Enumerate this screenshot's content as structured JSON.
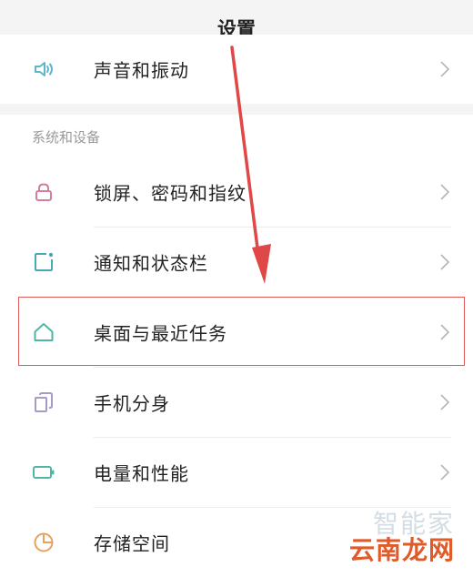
{
  "header": {
    "title": "设置"
  },
  "sections": {
    "system_title": "系统和设备"
  },
  "items": [
    {
      "label": "声音和振动",
      "icon": "speaker-icon",
      "color": "#5db6c9"
    },
    {
      "label": "锁屏、密码和指纹",
      "icon": "lock-icon",
      "color": "#d4809a"
    },
    {
      "label": "通知和状态栏",
      "icon": "notification-icon",
      "color": "#4aa5bd"
    },
    {
      "label": "桌面与最近任务",
      "icon": "home-icon",
      "color": "#4fb7a4"
    },
    {
      "label": "手机分身",
      "icon": "dual-app-icon",
      "color": "#a79ac4"
    },
    {
      "label": "电量和性能",
      "icon": "battery-icon",
      "color": "#4fb7a4"
    },
    {
      "label": "存储空间",
      "icon": "storage-icon",
      "color": "#e8a15e"
    }
  ],
  "annotation": {
    "highlight_color": "#e05a5a",
    "arrow_color": "#e04848"
  },
  "watermark": {
    "line1": "智能家",
    "line2": "云南龙网"
  }
}
